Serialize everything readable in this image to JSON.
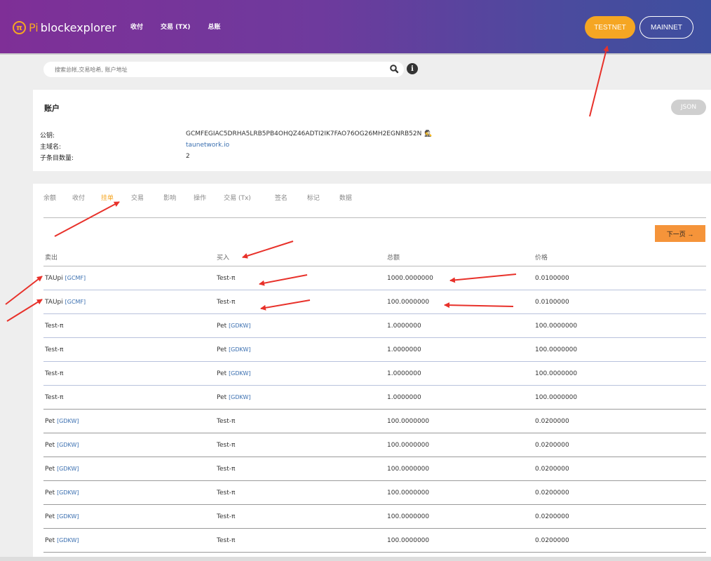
{
  "header": {
    "logo_glyph": "π",
    "brand_pi": "Pi",
    "brand_name": "blockexplorer",
    "nav": [
      "收付",
      "交易 (TX)",
      "总账"
    ],
    "testnet_label": "TESTNET",
    "mainnet_label": "MAINNET",
    "accent_color": "#f5a623"
  },
  "search": {
    "placeholder": "搜索总帐,交易哈希, 账户地址",
    "search_icon": "search-icon",
    "info_glyph": "i"
  },
  "account": {
    "title": "账户",
    "json_label": "JSON",
    "fields": [
      {
        "label": "公钥:",
        "value": "GCMFEGIAC5DRHA5LRB5PB4OHQZ46ADTI2IK7FAO76OG26MH2EGNRB52N"
      },
      {
        "label": "主域名:",
        "value": "taunetwork.io"
      },
      {
        "label": "子条目数量:",
        "value": "2"
      }
    ]
  },
  "tabs": {
    "items": [
      "余额",
      "收付",
      "挂单",
      "交易",
      "影响",
      "操作",
      "交易 (Tx)",
      "签名",
      "标记",
      "数据"
    ],
    "active_index": 2
  },
  "table": {
    "next_label": "下一页 →",
    "headers": [
      "卖出",
      "买入",
      "总额",
      "价格"
    ],
    "rows": [
      {
        "sell": "TAUpi",
        "sell_issuer": "[GCMF]",
        "buy": "Test-π",
        "buy_issuer": "",
        "amount": "1000.0000000",
        "price": "0.0100000"
      },
      {
        "sell": "TAUpi",
        "sell_issuer": "[GCMF]",
        "buy": "Test-π",
        "buy_issuer": "",
        "amount": "100.0000000",
        "price": "0.0100000"
      },
      {
        "sell": "Test-π",
        "sell_issuer": "",
        "buy": "Pet",
        "buy_issuer": "[GDKW]",
        "amount": "1.0000000",
        "price": "100.0000000"
      },
      {
        "sell": "Test-π",
        "sell_issuer": "",
        "buy": "Pet",
        "buy_issuer": "[GDKW]",
        "amount": "1.0000000",
        "price": "100.0000000"
      },
      {
        "sell": "Test-π",
        "sell_issuer": "",
        "buy": "Pet",
        "buy_issuer": "[GDKW]",
        "amount": "1.0000000",
        "price": "100.0000000"
      },
      {
        "sell": "Test-π",
        "sell_issuer": "",
        "buy": "Pet",
        "buy_issuer": "[GDKW]",
        "amount": "1.0000000",
        "price": "100.0000000"
      },
      {
        "sell": "Pet",
        "sell_issuer": "[GDKW]",
        "buy": "Test-π",
        "buy_issuer": "",
        "amount": "100.0000000",
        "price": "0.0200000"
      },
      {
        "sell": "Pet",
        "sell_issuer": "[GDKW]",
        "buy": "Test-π",
        "buy_issuer": "",
        "amount": "100.0000000",
        "price": "0.0200000"
      },
      {
        "sell": "Pet",
        "sell_issuer": "[GDKW]",
        "buy": "Test-π",
        "buy_issuer": "",
        "amount": "100.0000000",
        "price": "0.0200000"
      },
      {
        "sell": "Pet",
        "sell_issuer": "[GDKW]",
        "buy": "Test-π",
        "buy_issuer": "",
        "amount": "100.0000000",
        "price": "0.0200000"
      },
      {
        "sell": "Pet",
        "sell_issuer": "[GDKW]",
        "buy": "Test-π",
        "buy_issuer": "",
        "amount": "100.0000000",
        "price": "0.0200000"
      },
      {
        "sell": "Pet",
        "sell_issuer": "[GDKW]",
        "buy": "Test-π",
        "buy_issuer": "",
        "amount": "100.0000000",
        "price": "0.0200000"
      }
    ]
  },
  "annotation_color": "#e8312a"
}
